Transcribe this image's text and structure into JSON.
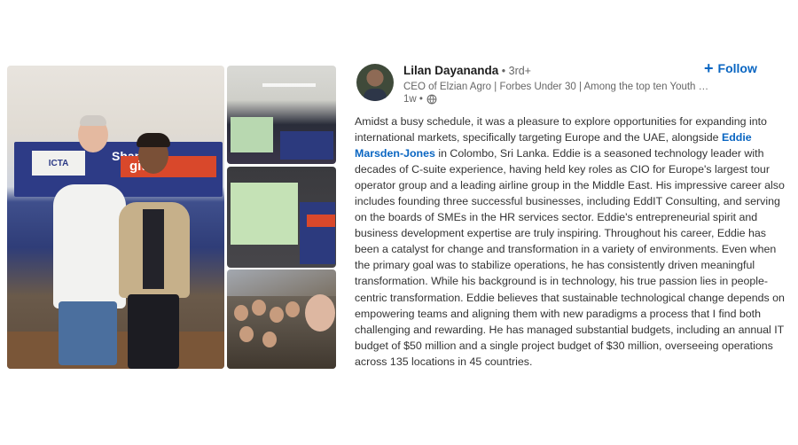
{
  "post": {
    "author": {
      "name": "Lilan Dayananda",
      "degree": " • 3rd+",
      "headline": "CEO of Elzian Agro | Forbes Under 30 | Among the top ten Youth So...",
      "time": "1w •"
    },
    "follow_label": "Follow",
    "follow_icon": "+",
    "body": {
      "text_1": "Amidst a busy schedule, it was a pleasure to explore opportunities for expanding into international markets, specifically targeting Europe and the UAE, alongside ",
      "mention": "Eddie Marsden-Jones",
      "text_2": " in Colombo, Sri Lanka. Eddie is a seasoned technology leader with decades of C-suite experience, having held key roles as CIO for Europe's largest tour operator group and a leading airline group in the Middle East. His impressive career also includes founding three successful businesses, including EddIT Consulting, and serving on the boards of SMEs in the HR services sector. Eddie's entrepreneurial spirit and business development expertise are truly inspiring. Throughout his career, Eddie has been a catalyst for change and transformation in a variety of environments. Even when the primary goal was to stabilize operations, he has consistently driven meaningful transformation. While his background is in technology, his true passion lies in people-centric transformation. Eddie believes that sustainable technological change depends on empowering teams and aligning them with new paradigms a process that I find both challenging and rewarding. He has managed substantial budgets, including an annual IT budget of $50 million and a single project budget of $30 million, overseeing operations across 135 locations in 45 countries."
    },
    "photo_banner_text": {
      "main_logo": "ICTA",
      "main_word_1": "Shaping",
      "main_word_2": "gita"
    }
  },
  "colors": {
    "link_blue": "#0a66c2",
    "banner_navy": "#2d3b86",
    "banner_red": "#d9482b"
  },
  "icons": {
    "globe": "globe-icon",
    "plus": "plus-icon"
  }
}
